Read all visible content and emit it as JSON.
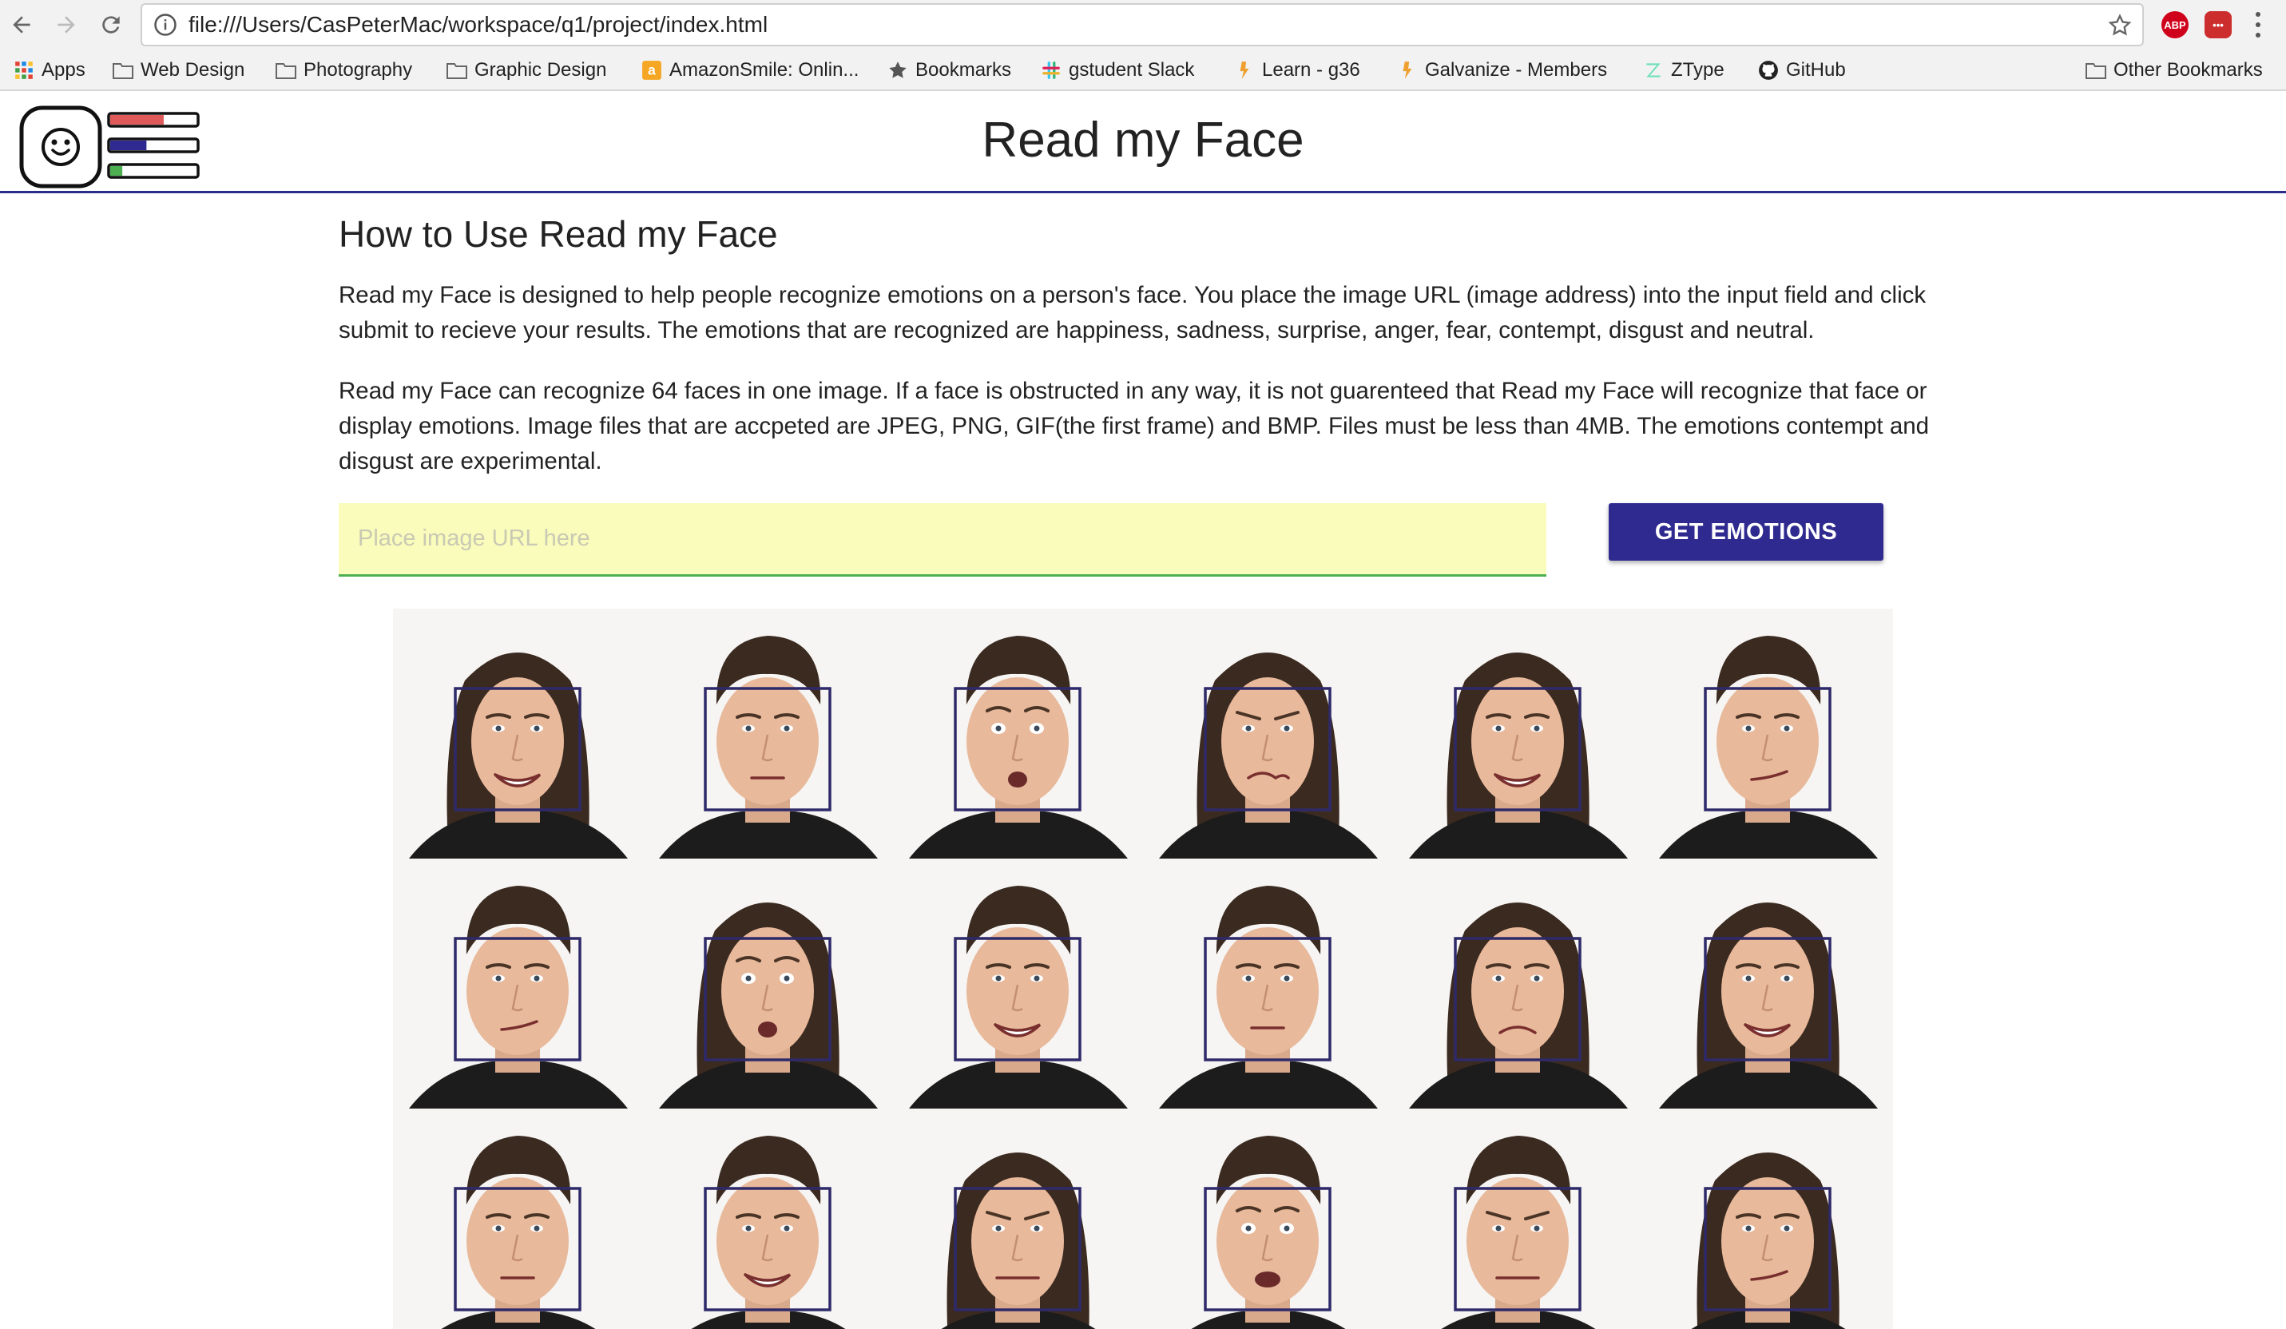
{
  "browser": {
    "url": "file:///Users/CasPeterMac/workspace/q1/project/index.html",
    "icons": {
      "back": "arrow-left-icon",
      "forward": "arrow-right-icon",
      "reload": "reload-icon",
      "info": "info-icon",
      "star": "star-icon"
    },
    "extensions": [
      {
        "name": "adblock-plus-icon",
        "label": "ABP",
        "color": "#d0021b"
      },
      {
        "name": "lastpass-icon",
        "label": "•••",
        "color": "#cc2d2d"
      }
    ],
    "bookmarks": [
      {
        "label": "Apps",
        "icon": "apps-grid-icon"
      },
      {
        "label": "Web Design",
        "icon": "folder-icon"
      },
      {
        "label": "Photography",
        "icon": "folder-icon"
      },
      {
        "label": "Graphic Design",
        "icon": "folder-icon"
      },
      {
        "label": "AmazonSmile: Onlin...",
        "icon": "amazon-icon"
      },
      {
        "label": "Bookmarks",
        "icon": "star-icon"
      },
      {
        "label": "gstudent Slack",
        "icon": "slack-icon"
      },
      {
        "label": "Learn - g36",
        "icon": "galvanize-icon"
      },
      {
        "label": "Galvanize - Members",
        "icon": "galvanize-icon"
      },
      {
        "label": "ZType",
        "icon": "ztype-icon"
      },
      {
        "label": "GitHub",
        "icon": "github-icon"
      }
    ],
    "other_bookmarks": "Other Bookmarks"
  },
  "app": {
    "title": "Read my Face",
    "logo_icon": "smiley-face-logo-icon",
    "logo_bars": [
      {
        "color": "#e05a5a",
        "fill": 0.62
      },
      {
        "color": "#2e2a8f",
        "fill": 0.42
      },
      {
        "color": "#4caf50",
        "fill": 0.14
      }
    ]
  },
  "main": {
    "heading": "How to Use Read my Face",
    "paragraph1": "Read my Face is designed to help people recognize emotions on a person's face. You place the image URL (image address) into the input field and click submit to recieve your results. The emotions that are recognized are happiness, sadness, surprise, anger, fear, contempt, disgust and neutral.",
    "paragraph2": "Read my Face can recognize 64 faces in one image. If a face is obstructed in any way, it is not guarenteed that Read my Face will recognize that face or display emotions. Image files that are accpeted are JPEG, PNG, GIF(the first frame) and BMP. Files must be less than 4MB. The emotions contempt and disgust are experimental.",
    "input_placeholder": "Place image URL here",
    "submit_label": "GET EMOTIONS"
  },
  "faces": {
    "box_color": "#2e2a6a",
    "rows": [
      [
        "female-happy",
        "male-neutral",
        "male-surprised",
        "female-disgust",
        "female-happy",
        "male-contempt"
      ],
      [
        "male-contempt",
        "female-surprised",
        "male-happy",
        "male-neutral",
        "female-sad",
        "female-happy"
      ],
      [
        "male-neutral",
        "male-happy",
        "female-angry",
        "male-fear",
        "male-angry",
        "female-contempt"
      ]
    ]
  }
}
